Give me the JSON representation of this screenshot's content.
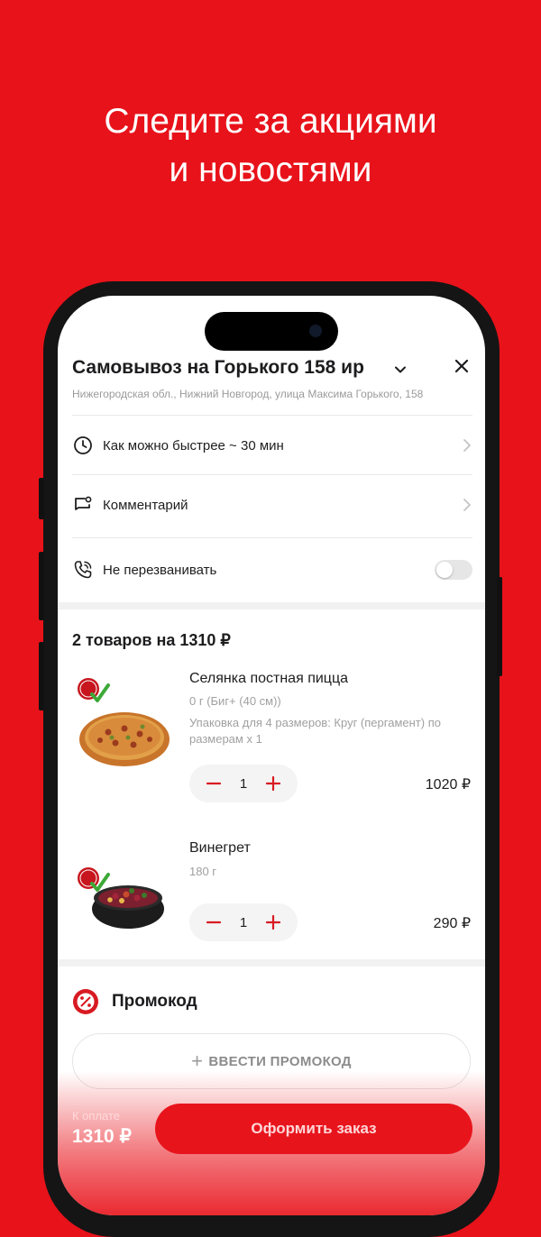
{
  "promo": {
    "line1": "Следите за акциями",
    "line2": "и новостями"
  },
  "header": {
    "title": "Самовывоз на Горького 158 ир",
    "address": "Нижегородская обл., Нижний Новгород, улица Максима Горького, 158"
  },
  "options": {
    "time_label": "Как можно быстрее  ~ 30 мин",
    "comment_label": "Комментарий",
    "no_call_label": "Не перезванивать",
    "no_call_enabled": false
  },
  "cart": {
    "summary": "2 товаров на 1310 ₽",
    "items": [
      {
        "name": "Селянка постная пицца",
        "weight": "0 г (Биг+  (40 см))",
        "extra": "Упаковка для 4 размеров: Круг (пергамент) по размерам х 1",
        "qty": "1",
        "price": "1020 ₽"
      },
      {
        "name": "Винегрет",
        "weight": "180 г",
        "qty": "1",
        "price": "290 ₽"
      }
    ]
  },
  "promocode": {
    "title": "Промокод",
    "button": "ВВЕСТИ ПРОМОКОД"
  },
  "footer": {
    "pay_label": "К оплате",
    "pay_amount": "1310 ₽",
    "checkout": "Оформить заказ"
  },
  "colors": {
    "brand": "#e8121a",
    "accent_red": "#d81a22"
  }
}
